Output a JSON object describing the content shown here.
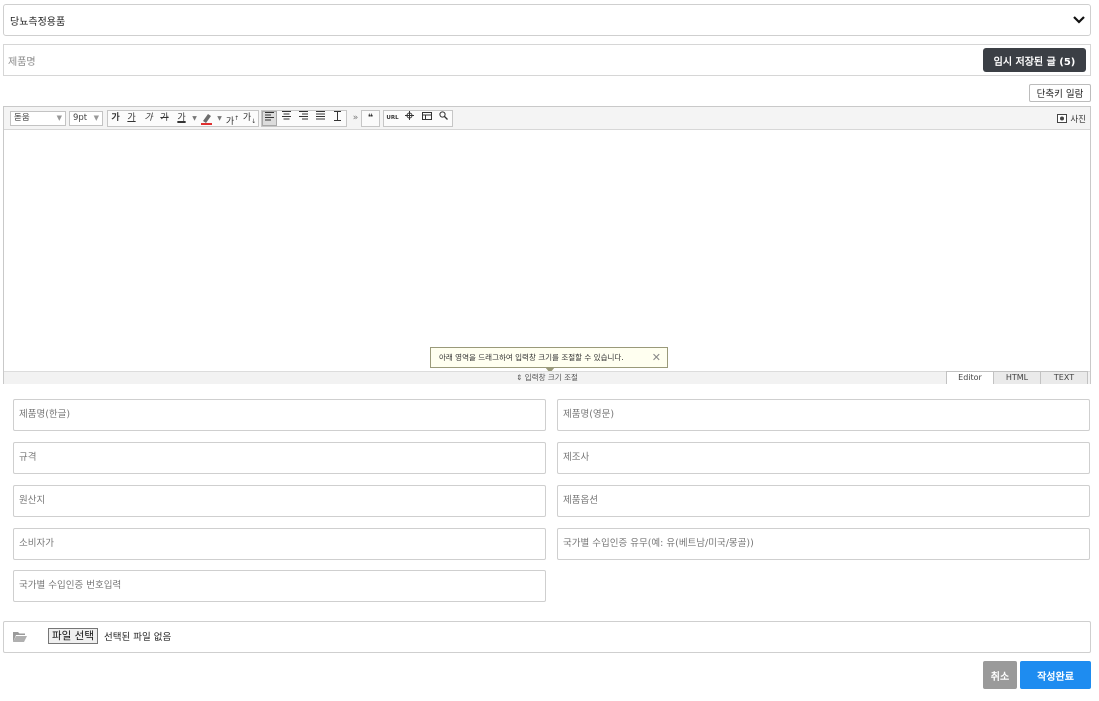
{
  "category": {
    "selected": "당뇨측정용품"
  },
  "title": {
    "placeholder": "제품명",
    "temp_saved_label": "임시 저장된 글 (5)"
  },
  "shortcut_label": "단축키 일람",
  "editor": {
    "font_family": "돋움",
    "font_size": "9pt",
    "toolbar": {
      "bold": "가",
      "underline": "가",
      "italic": "가",
      "strike": "가",
      "font_color": "가",
      "superscript": "가",
      "subscript": "가",
      "quote": "❝",
      "url": "URL"
    },
    "photo_label": "사진",
    "resize_tip": "아래 영역을 드래그하여 입력창 크기를 조절할 수 있습니다.",
    "resize_bar_label": "입력창 크기 조절",
    "modes": [
      "Editor",
      "HTML",
      "TEXT"
    ],
    "active_mode": "Editor"
  },
  "fields": {
    "name_kr": "제품명(한글)",
    "name_en": "제품명(영문)",
    "spec": "규격",
    "manufacturer": "제조사",
    "origin": "원산지",
    "option": "제품옵션",
    "consumer_price": "소비자가",
    "import_cert": "국가별 수입인증 유무(예: 유(베트남/미국/몽골))",
    "import_cert_no": "국가별 수입인증 번호입력"
  },
  "file": {
    "button_label": "파일 선택",
    "status": "선택된 파일 없음"
  },
  "actions": {
    "cancel": "취소",
    "submit": "작성완료"
  },
  "colors": {
    "accent": "#1e8cf0",
    "dark_button": "#3b3f45",
    "cancel_button": "#9a9a9a"
  }
}
